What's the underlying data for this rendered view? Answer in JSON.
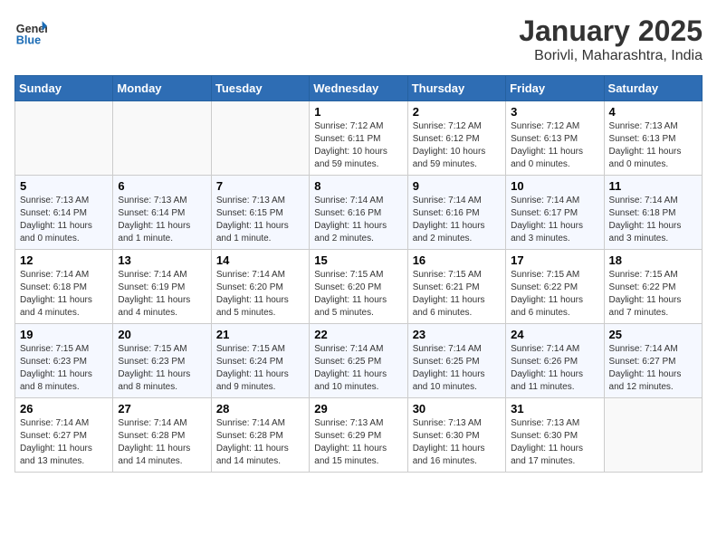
{
  "header": {
    "logo_line1": "General",
    "logo_line2": "Blue",
    "month_year": "January 2025",
    "location": "Borivli, Maharashtra, India"
  },
  "weekdays": [
    "Sunday",
    "Monday",
    "Tuesday",
    "Wednesday",
    "Thursday",
    "Friday",
    "Saturday"
  ],
  "weeks": [
    [
      {
        "day": "",
        "info": ""
      },
      {
        "day": "",
        "info": ""
      },
      {
        "day": "",
        "info": ""
      },
      {
        "day": "1",
        "info": "Sunrise: 7:12 AM\nSunset: 6:11 PM\nDaylight: 10 hours and 59 minutes."
      },
      {
        "day": "2",
        "info": "Sunrise: 7:12 AM\nSunset: 6:12 PM\nDaylight: 10 hours and 59 minutes."
      },
      {
        "day": "3",
        "info": "Sunrise: 7:12 AM\nSunset: 6:13 PM\nDaylight: 11 hours and 0 minutes."
      },
      {
        "day": "4",
        "info": "Sunrise: 7:13 AM\nSunset: 6:13 PM\nDaylight: 11 hours and 0 minutes."
      }
    ],
    [
      {
        "day": "5",
        "info": "Sunrise: 7:13 AM\nSunset: 6:14 PM\nDaylight: 11 hours and 0 minutes."
      },
      {
        "day": "6",
        "info": "Sunrise: 7:13 AM\nSunset: 6:14 PM\nDaylight: 11 hours and 1 minute."
      },
      {
        "day": "7",
        "info": "Sunrise: 7:13 AM\nSunset: 6:15 PM\nDaylight: 11 hours and 1 minute."
      },
      {
        "day": "8",
        "info": "Sunrise: 7:14 AM\nSunset: 6:16 PM\nDaylight: 11 hours and 2 minutes."
      },
      {
        "day": "9",
        "info": "Sunrise: 7:14 AM\nSunset: 6:16 PM\nDaylight: 11 hours and 2 minutes."
      },
      {
        "day": "10",
        "info": "Sunrise: 7:14 AM\nSunset: 6:17 PM\nDaylight: 11 hours and 3 minutes."
      },
      {
        "day": "11",
        "info": "Sunrise: 7:14 AM\nSunset: 6:18 PM\nDaylight: 11 hours and 3 minutes."
      }
    ],
    [
      {
        "day": "12",
        "info": "Sunrise: 7:14 AM\nSunset: 6:18 PM\nDaylight: 11 hours and 4 minutes."
      },
      {
        "day": "13",
        "info": "Sunrise: 7:14 AM\nSunset: 6:19 PM\nDaylight: 11 hours and 4 minutes."
      },
      {
        "day": "14",
        "info": "Sunrise: 7:14 AM\nSunset: 6:20 PM\nDaylight: 11 hours and 5 minutes."
      },
      {
        "day": "15",
        "info": "Sunrise: 7:15 AM\nSunset: 6:20 PM\nDaylight: 11 hours and 5 minutes."
      },
      {
        "day": "16",
        "info": "Sunrise: 7:15 AM\nSunset: 6:21 PM\nDaylight: 11 hours and 6 minutes."
      },
      {
        "day": "17",
        "info": "Sunrise: 7:15 AM\nSunset: 6:22 PM\nDaylight: 11 hours and 6 minutes."
      },
      {
        "day": "18",
        "info": "Sunrise: 7:15 AM\nSunset: 6:22 PM\nDaylight: 11 hours and 7 minutes."
      }
    ],
    [
      {
        "day": "19",
        "info": "Sunrise: 7:15 AM\nSunset: 6:23 PM\nDaylight: 11 hours and 8 minutes."
      },
      {
        "day": "20",
        "info": "Sunrise: 7:15 AM\nSunset: 6:23 PM\nDaylight: 11 hours and 8 minutes."
      },
      {
        "day": "21",
        "info": "Sunrise: 7:15 AM\nSunset: 6:24 PM\nDaylight: 11 hours and 9 minutes."
      },
      {
        "day": "22",
        "info": "Sunrise: 7:14 AM\nSunset: 6:25 PM\nDaylight: 11 hours and 10 minutes."
      },
      {
        "day": "23",
        "info": "Sunrise: 7:14 AM\nSunset: 6:25 PM\nDaylight: 11 hours and 10 minutes."
      },
      {
        "day": "24",
        "info": "Sunrise: 7:14 AM\nSunset: 6:26 PM\nDaylight: 11 hours and 11 minutes."
      },
      {
        "day": "25",
        "info": "Sunrise: 7:14 AM\nSunset: 6:27 PM\nDaylight: 11 hours and 12 minutes."
      }
    ],
    [
      {
        "day": "26",
        "info": "Sunrise: 7:14 AM\nSunset: 6:27 PM\nDaylight: 11 hours and 13 minutes."
      },
      {
        "day": "27",
        "info": "Sunrise: 7:14 AM\nSunset: 6:28 PM\nDaylight: 11 hours and 14 minutes."
      },
      {
        "day": "28",
        "info": "Sunrise: 7:14 AM\nSunset: 6:28 PM\nDaylight: 11 hours and 14 minutes."
      },
      {
        "day": "29",
        "info": "Sunrise: 7:13 AM\nSunset: 6:29 PM\nDaylight: 11 hours and 15 minutes."
      },
      {
        "day": "30",
        "info": "Sunrise: 7:13 AM\nSunset: 6:30 PM\nDaylight: 11 hours and 16 minutes."
      },
      {
        "day": "31",
        "info": "Sunrise: 7:13 AM\nSunset: 6:30 PM\nDaylight: 11 hours and 17 minutes."
      },
      {
        "day": "",
        "info": ""
      }
    ]
  ]
}
